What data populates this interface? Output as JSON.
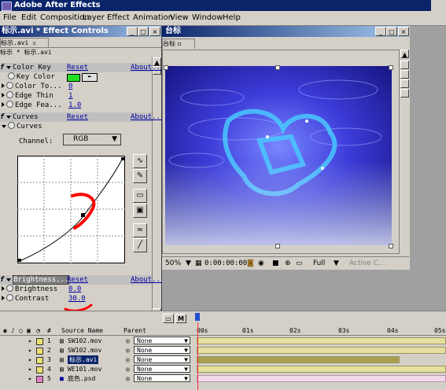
{
  "app": {
    "title": "Adobe After Effects"
  },
  "menu": [
    "File",
    "Edit",
    "Composition",
    "Layer",
    "Effect",
    "Animation",
    "View",
    "Window",
    "Help"
  ],
  "effect_controls": {
    "title": "标示.avi * Effect Controls",
    "tab": "标示.avi",
    "breadcrumb": "标示 * 标示.avi",
    "color_key": {
      "name": "Color Key",
      "reset": "Reset",
      "about": "About...",
      "key_color_label": "Key Color",
      "key_color": "#22e022",
      "color_tol_label": "Color To...",
      "color_tol": "0",
      "edge_thin_label": "Edge Thin",
      "edge_thin": "1",
      "edge_fea_label": "Edge Fea...",
      "edge_fea": "1.0"
    },
    "curves": {
      "name": "Curves",
      "reset": "Reset",
      "about": "About...",
      "sub": "Curves",
      "channel_label": "Channel:",
      "channel": "RGB"
    },
    "bc": {
      "name": "Brightness...",
      "reset": "Reset",
      "about": "About...",
      "brightness_label": "Brightness",
      "brightness": "0.0",
      "contrast_label": "Contrast",
      "contrast": "30.0"
    }
  },
  "comp": {
    "title": "台标",
    "tab": "台标",
    "zoom": "50%",
    "timecode": "0:00:00:00",
    "resolution": "Full",
    "camera": "Active C..."
  },
  "timeline": {
    "headers": {
      "num": "#",
      "source": "Source Name",
      "parent": "Parent"
    },
    "ticks": [
      "00s",
      "01s",
      "02s",
      "03s",
      "04s",
      "05s"
    ],
    "layers": [
      {
        "num": "1",
        "name": "SW102.mov",
        "parent": "None",
        "color": "#e8e070"
      },
      {
        "num": "2",
        "name": "SW102.mov",
        "parent": "None",
        "color": "#e8e070"
      },
      {
        "num": "3",
        "name": "标示.avi",
        "parent": "None",
        "color": "#e8e070"
      },
      {
        "num": "4",
        "name": "WE101.mov",
        "parent": "None",
        "color": "#e8e070"
      },
      {
        "num": "5",
        "name": "底色.psd",
        "parent": "None",
        "color": "#e080c0"
      }
    ]
  },
  "colors": {
    "title_bg": "#0a246a",
    "accent_red": "#ff0000",
    "link": "#0000a0"
  }
}
